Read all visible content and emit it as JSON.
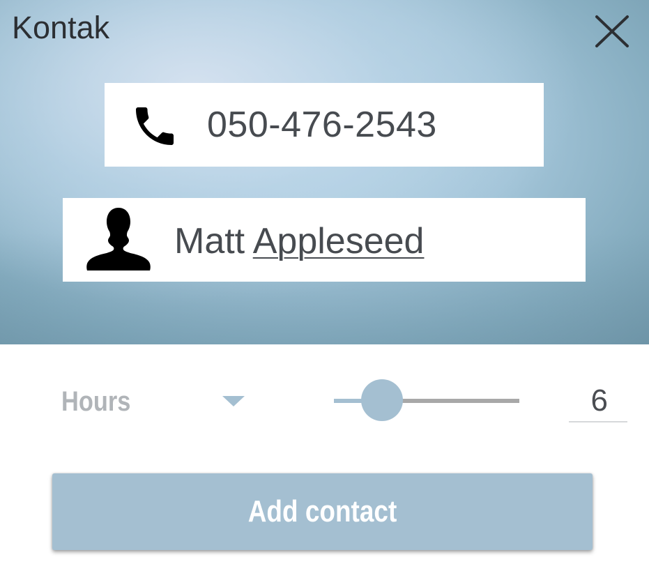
{
  "dialog": {
    "title": "Kontak"
  },
  "contact": {
    "phone": "050-476-2543",
    "first_name": "Matt",
    "last_name": "Appleseed"
  },
  "duration": {
    "unit_label": "Hours",
    "value": "6",
    "slider_fraction": 0.26
  },
  "actions": {
    "add_label": "Add contact"
  },
  "icons": {
    "close": "close-icon",
    "phone": "phone-icon",
    "person": "person-icon",
    "dropdown": "chevron-down-icon"
  },
  "colors": {
    "accent": "#a4bfd1",
    "text": "#474b50",
    "muted": "#b0b4b8",
    "track": "#a8a8a8"
  }
}
